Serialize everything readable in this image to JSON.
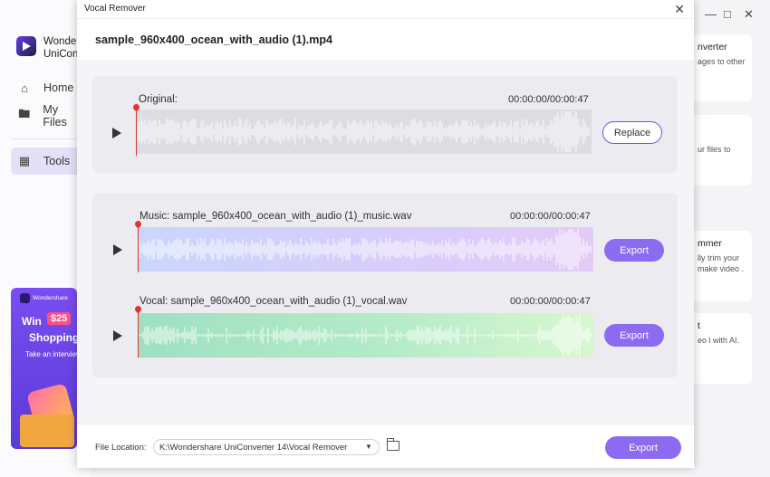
{
  "background_app": {
    "name_line1": "Wondershare",
    "name_line2": "UniConverter",
    "nav": [
      {
        "label": "Home",
        "icon": "home-icon"
      },
      {
        "label": "My Files",
        "icon": "folder-icon"
      },
      {
        "label": "Tools",
        "icon": "tools-icon",
        "active": true
      }
    ],
    "promo": {
      "brand": "Wondershare",
      "win": "Win",
      "amount": "$25",
      "shopping": "Shopping",
      "take": "Take an interview"
    },
    "cards": [
      {
        "title": "nverter",
        "text": "ages to other"
      },
      {
        "title": "",
        "text": "ur files to"
      },
      {
        "title": "mmer",
        "text": "lly trim your make video ."
      },
      {
        "title": "t",
        "text": "eo l with AI."
      }
    ]
  },
  "dialog": {
    "title": "Vocal Remover",
    "file_name": "sample_960x400_ocean_with_audio (1).mp4",
    "original": {
      "label": "Original:",
      "time": "00:00:00/00:00:47",
      "button": "Replace"
    },
    "music": {
      "label": "Music: sample_960x400_ocean_with_audio (1)_music.wav",
      "time": "00:00:00/00:00:47",
      "button": "Export"
    },
    "vocal": {
      "label": "Vocal: sample_960x400_ocean_with_audio (1)_vocal.wav",
      "time": "00:00:00/00:00:47",
      "button": "Export"
    },
    "footer": {
      "location_label": "File Location:",
      "location_value": "K:\\Wondershare UniConverter 14\\Vocal Remover",
      "export_button": "Export"
    }
  },
  "colors": {
    "accent": "#8b6cf0",
    "playhead": "#e0342c"
  }
}
